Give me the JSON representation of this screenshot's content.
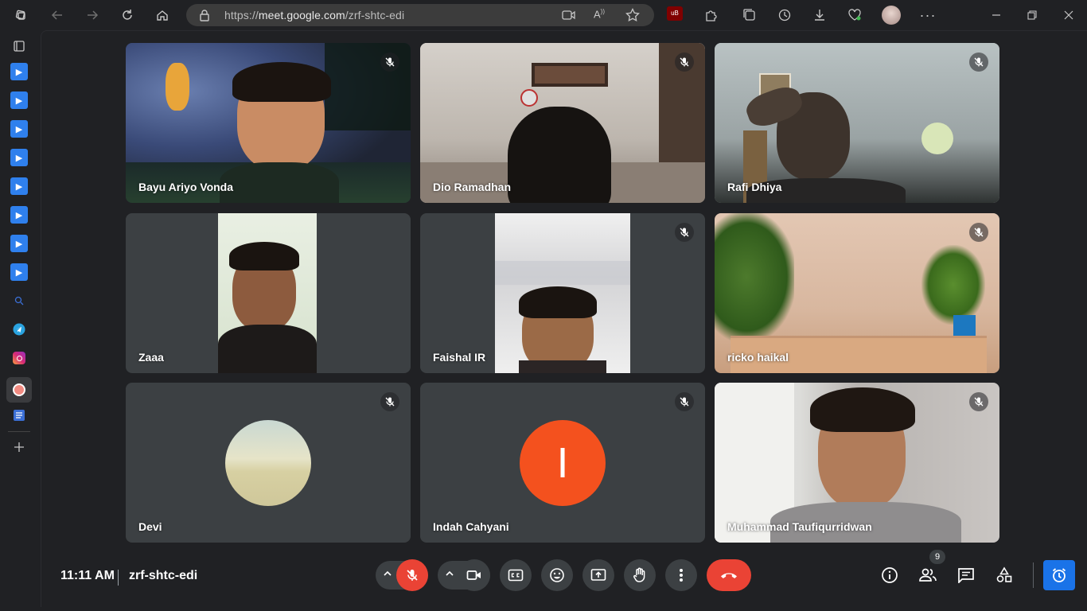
{
  "browser": {
    "url_prefix": "https://",
    "url_host": "meet.google.com",
    "url_path": "/zrf-shtc-edi",
    "ext_badge": "39"
  },
  "participants": [
    {
      "name": "Bayu Ariyo Vonda"
    },
    {
      "name": "Dio Ramadhan"
    },
    {
      "name": "Rafi Dhiya"
    },
    {
      "name": "Zaaa"
    },
    {
      "name": "Faishal IR"
    },
    {
      "name": "ricko haikal"
    },
    {
      "name": "Devi"
    },
    {
      "name": "Indah Cahyani",
      "initial": "I"
    },
    {
      "name": "Muhammad Taufiqurridwan"
    }
  ],
  "meeting": {
    "time": "11:11 AM",
    "code": "zrf-shtc-edi",
    "people_count": "9"
  },
  "colors": {
    "accent_blue": "#1a73e8",
    "hangup_red": "#ea4335",
    "avatar_orange": "#f4511e"
  }
}
